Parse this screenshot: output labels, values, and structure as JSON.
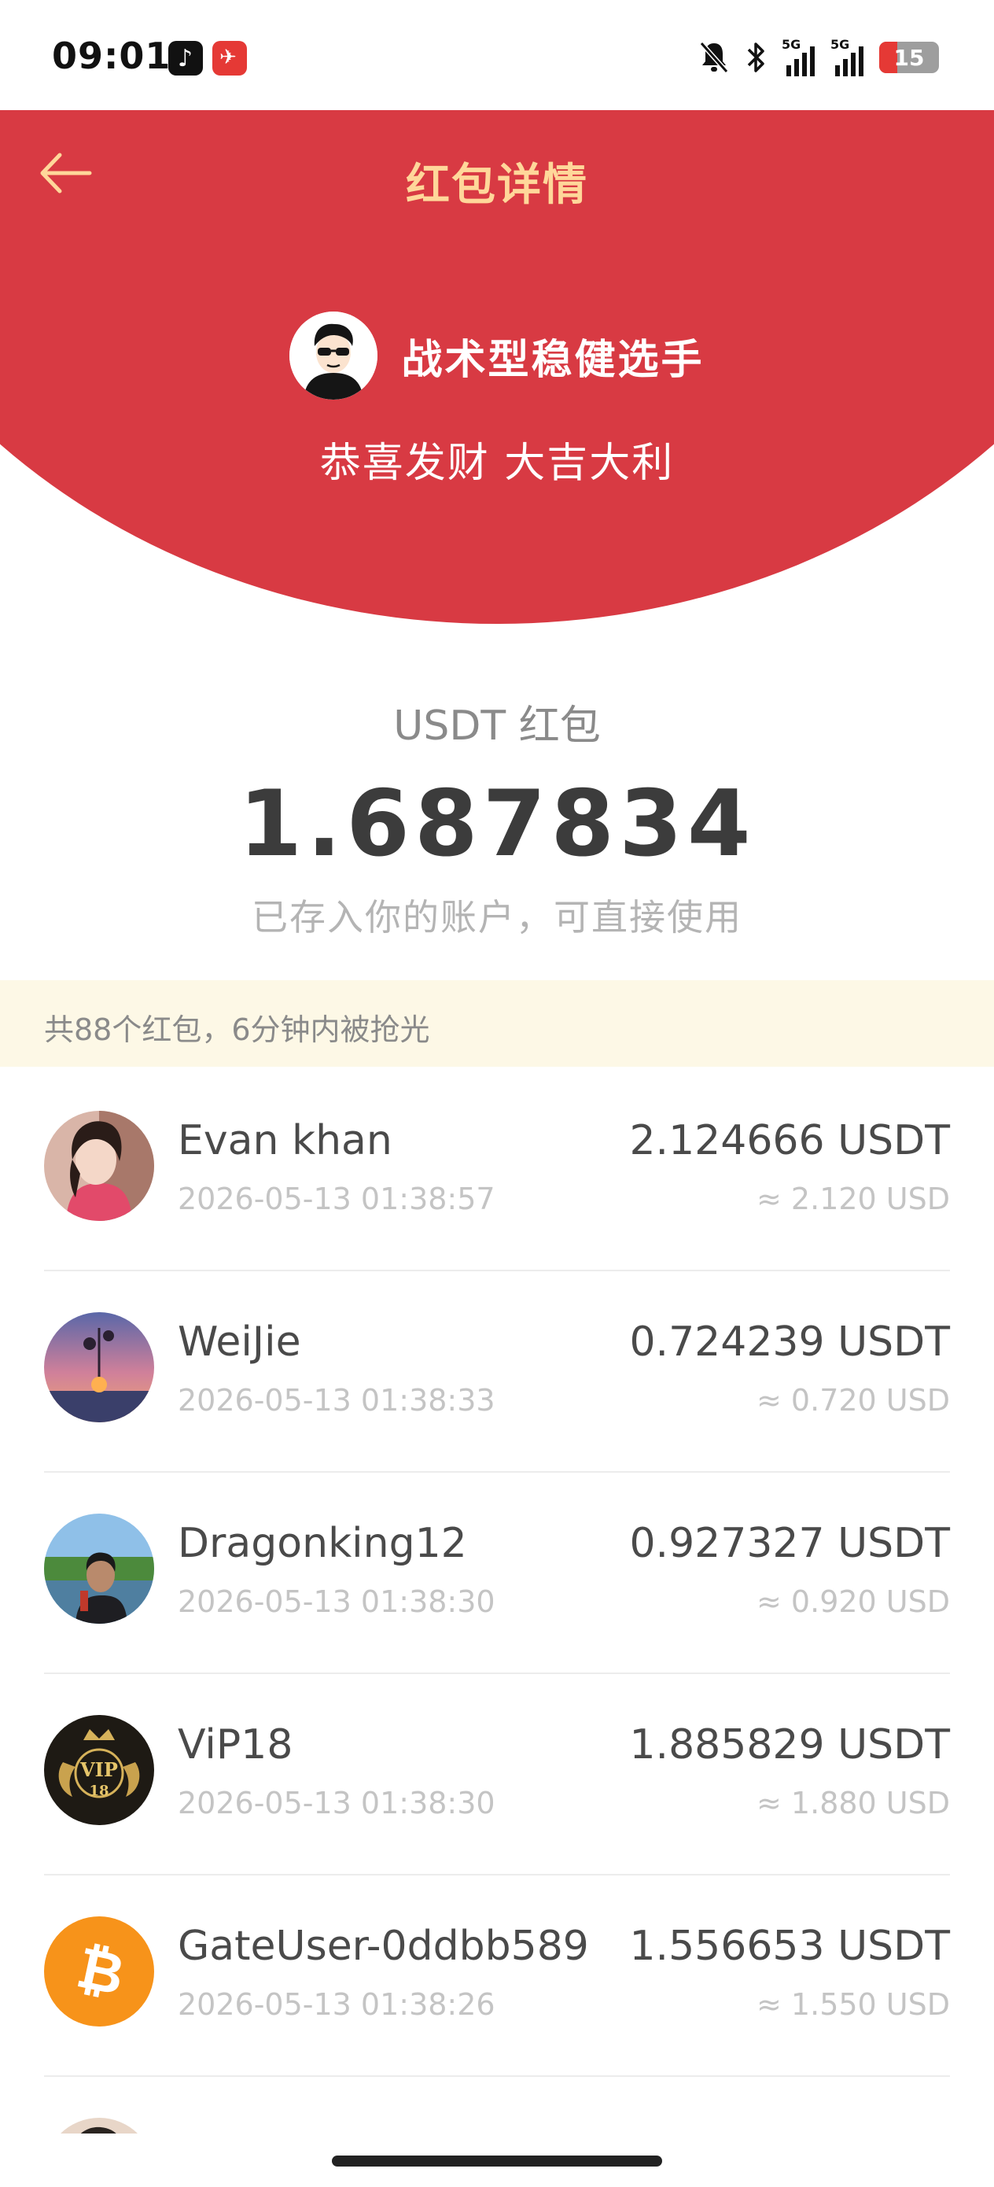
{
  "status_bar": {
    "time": "09:01",
    "icons": [
      "tiktok-icon",
      "news-app-icon",
      "mute-bell-icon",
      "bluetooth-icon",
      "signal-5g-icon",
      "signal-5g-icon",
      "battery-icon"
    ],
    "battery_level": "15",
    "network_1": "5G",
    "network_2": "5G"
  },
  "header": {
    "title": "红包详情",
    "back_icon": "arrow-left-icon"
  },
  "sender": {
    "name": "战术型稳健选手",
    "blessing": "恭喜发财 大吉大利"
  },
  "received": {
    "coin_label": "USDT 红包",
    "amount": "1.687834",
    "note": "已存入你的账户，可直接使用"
  },
  "summary": "共88个红包，6分钟内被抢光",
  "claims": [
    {
      "name": "Evan khan",
      "time": "2026-05-13 01:38:57",
      "amount": "2.124666 USDT",
      "usd": "≈ 2.120 USD",
      "avatar_color": "#c98f86"
    },
    {
      "name": "WeiJie",
      "time": "2026-05-13 01:38:33",
      "amount": "0.724239 USDT",
      "usd": "≈ 0.720 USD",
      "avatar_color": "#6b6fa8"
    },
    {
      "name": "Dragonking12",
      "time": "2026-05-13 01:38:30",
      "amount": "0.927327 USDT",
      "usd": "≈ 0.920 USD",
      "avatar_color": "#5b8fb5"
    },
    {
      "name": "ViP18",
      "time": "2026-05-13 01:38:30",
      "amount": "1.885829 USDT",
      "usd": "≈ 1.880 USD",
      "avatar_color": "#1e1a14"
    },
    {
      "name": "GateUser-0ddbb589",
      "time": "2026-05-13 01:38:26",
      "amount": "1.556653 USDT",
      "usd": "≈ 1.550 USD",
      "avatar_color": "#f7931a"
    }
  ],
  "colors": {
    "header_red": "#d83a43",
    "title_gold": "#ffd79a",
    "summary_bg": "#fdf8e6"
  }
}
